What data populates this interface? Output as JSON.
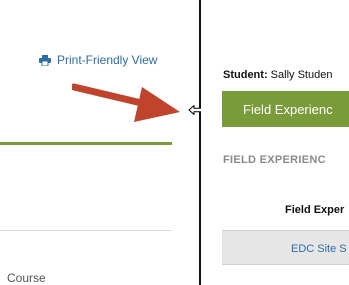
{
  "left_pane": {
    "print_link_label": "Print-Friendly View",
    "course_text": "Course"
  },
  "right_pane": {
    "student_label": "Student:",
    "student_name": "Sally Studen",
    "field_experience_button": "Field Experienc",
    "section_heading": "FIELD EXPERIENC",
    "table": {
      "column_header": "Field Exper",
      "rows": [
        {
          "link": "EDC Site S"
        }
      ]
    }
  },
  "colors": {
    "accent_green": "#7a9b3a",
    "link_blue": "#2e6da4",
    "annotation_arrow": "#c0432b",
    "splitter": "#111111"
  },
  "icons": {
    "print": "printer-icon",
    "resize_cursor": "horizontal-resize-cursor-icon",
    "annotation_arrow": "red-arrow-icon"
  }
}
